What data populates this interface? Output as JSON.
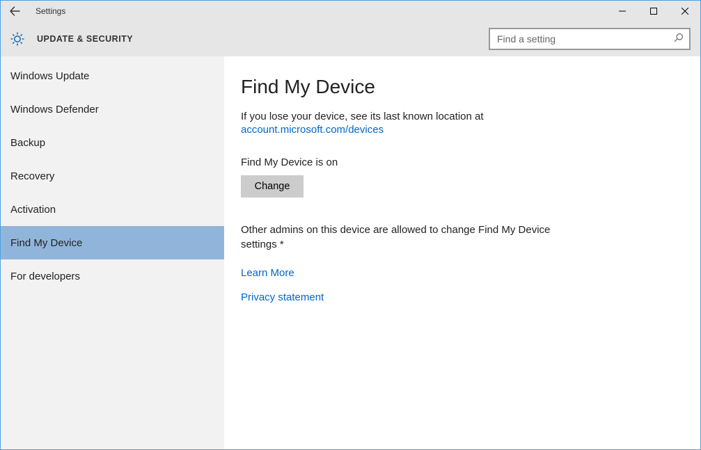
{
  "window": {
    "title": "Settings"
  },
  "header": {
    "section_title": "UPDATE & SECURITY"
  },
  "search": {
    "placeholder": "Find a setting"
  },
  "sidebar": {
    "items": [
      {
        "label": "Windows Update",
        "selected": false
      },
      {
        "label": "Windows Defender",
        "selected": false
      },
      {
        "label": "Backup",
        "selected": false
      },
      {
        "label": "Recovery",
        "selected": false
      },
      {
        "label": "Activation",
        "selected": false
      },
      {
        "label": "Find My Device",
        "selected": true
      },
      {
        "label": "For developers",
        "selected": false
      }
    ]
  },
  "main": {
    "heading": "Find My Device",
    "intro": "If you lose your device, see its last known location at",
    "intro_link": "account.microsoft.com/devices",
    "status": "Find My Device is on",
    "change_button": "Change",
    "admin_note": "Other admins on this device are allowed to change Find My Device settings *",
    "learn_more": "Learn More",
    "privacy": "Privacy statement"
  }
}
